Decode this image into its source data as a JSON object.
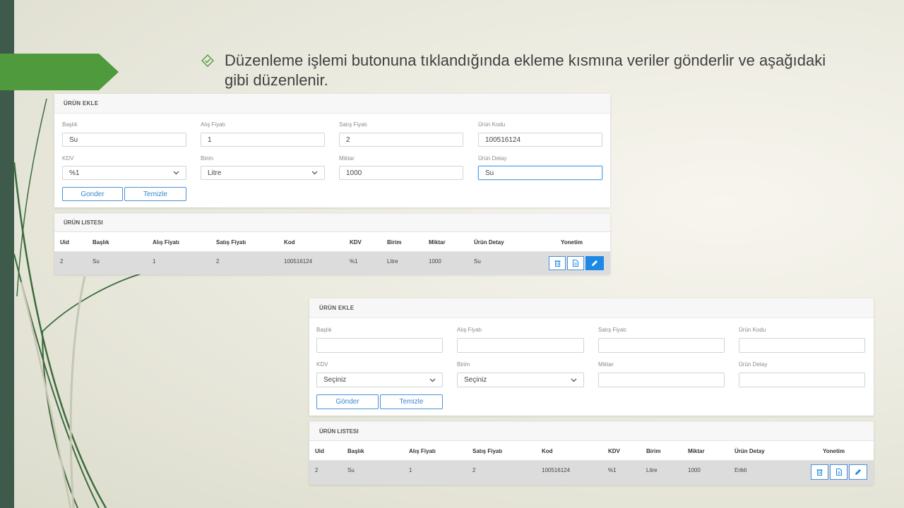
{
  "slide": {
    "bullet_text": "Düzenleme işlemi butonuna tıklandığında ekleme kısmına veriler gönderlir ve aşağıdaki gibi düzenlenir."
  },
  "top_panel": {
    "form_title": "ÜRÜN EKLE",
    "labels": {
      "baslik": "Başlık",
      "alis": "Alış Fiyatı",
      "satis": "Satış Fiyatı",
      "kod": "Ürün Kodu",
      "kdv": "KDV",
      "birim": "Birim",
      "miktar": "Miktar",
      "detay": "Ürün Detay"
    },
    "values": {
      "baslik": "Su",
      "alis": "1",
      "satis": "2",
      "kod": "100516124",
      "kdv": "%1",
      "birim": "Litre",
      "miktar": "1000",
      "detay": "Su"
    },
    "buttons": {
      "submit": "Gonder",
      "clear": "Temizle"
    },
    "list_title": "ÜRÜN LISTESI",
    "columns": [
      "Uid",
      "Başlık",
      "Alış Fiyatı",
      "Satış Fiyatı",
      "Kod",
      "KDV",
      "Birim",
      "Miktar",
      "Ürün Detay",
      "Yonetim"
    ],
    "rows": [
      [
        "2",
        "Su",
        "1",
        "2",
        "100516124",
        "%1",
        "Litre",
        "1000",
        "Su"
      ]
    ]
  },
  "bottom_panel": {
    "form_title": "ÜRÜN EKLE",
    "labels": {
      "baslik": "Başlık",
      "alis": "Alış Fiyatı",
      "satis": "Satış Fiyatı",
      "kod": "Ürün Kodu",
      "kdv": "KDV",
      "birim": "Birim",
      "miktar": "Miktar",
      "detay": "Ürün Detay"
    },
    "values": {
      "baslik": "",
      "alis": "",
      "satis": "",
      "kod": "",
      "kdv": "Seçiniz",
      "birim": "Seçiniz",
      "miktar": "",
      "detay": ""
    },
    "buttons": {
      "submit": "Gönder",
      "clear": "Temizle"
    },
    "list_title": "ÜRÜN LISTESI",
    "columns": [
      "Uid",
      "Başlık",
      "Alış Fiyatı",
      "Satış Fiyatı",
      "Kod",
      "KDV",
      "Birim",
      "Miktar",
      "Ürün Detay",
      "Yonetim"
    ],
    "rows": [
      [
        "2",
        "Su",
        "1",
        "2",
        "100516124",
        "%1",
        "Litre",
        "1000",
        "Erikli"
      ]
    ]
  },
  "colors": {
    "accent": "#1e88e5",
    "green_tab": "#4f9a3d",
    "sidebar": "#3e5a4a"
  },
  "icons": {
    "bullet": "diamond-check-icon",
    "delete": "trash-icon",
    "view": "document-icon",
    "edit": "pencil-icon"
  }
}
